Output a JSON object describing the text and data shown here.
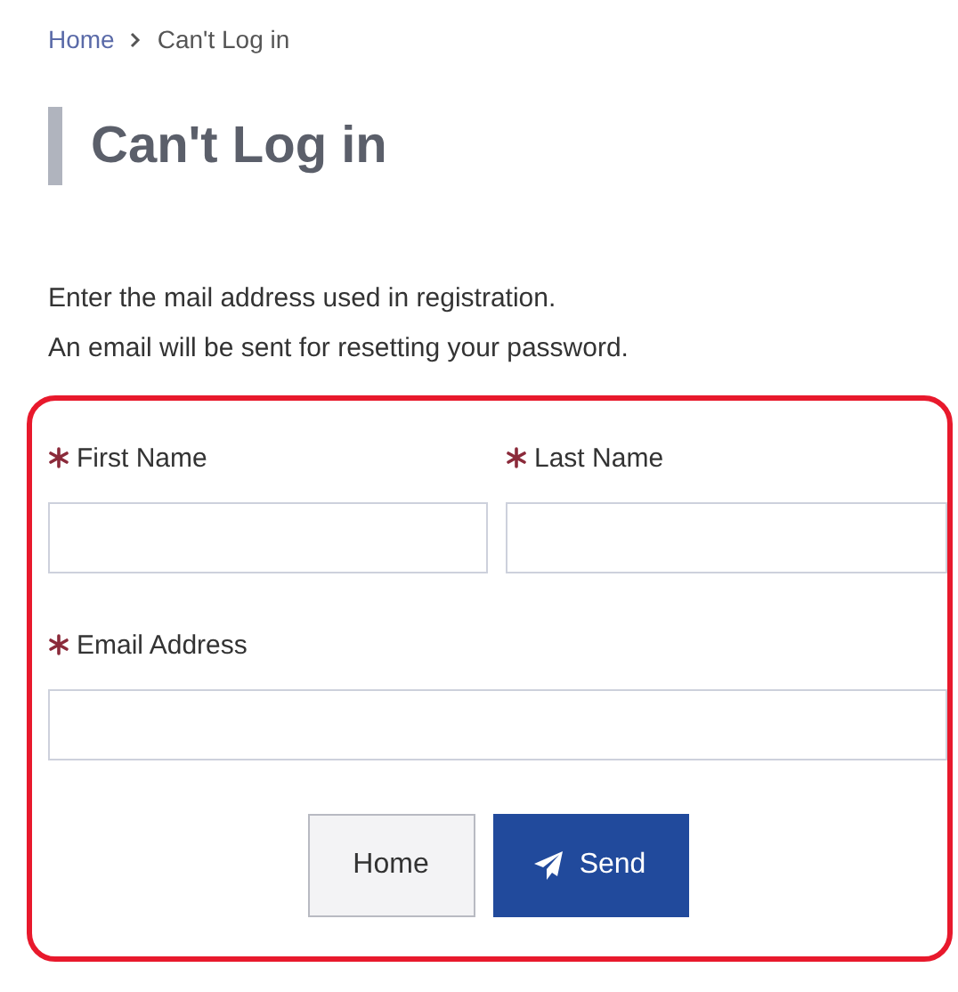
{
  "breadcrumb": [
    {
      "label": "Home",
      "kind": "link"
    },
    {
      "label": "Can't Log in",
      "kind": "current"
    }
  ],
  "title": "Can't Log in",
  "intro": [
    "Enter the mail address used in registration.",
    "An email will be sent for resetting your password."
  ],
  "form": {
    "highlighted": true,
    "rows": [
      [
        {
          "label": "First Name",
          "required": true
        },
        {
          "label": "Last Name",
          "required": true
        }
      ],
      [
        {
          "label": "Email Address",
          "required": true
        }
      ]
    ],
    "buttons": [
      {
        "label": "Home",
        "kind": "secondary"
      },
      {
        "label": "Send",
        "kind": "primary"
      }
    ]
  }
}
